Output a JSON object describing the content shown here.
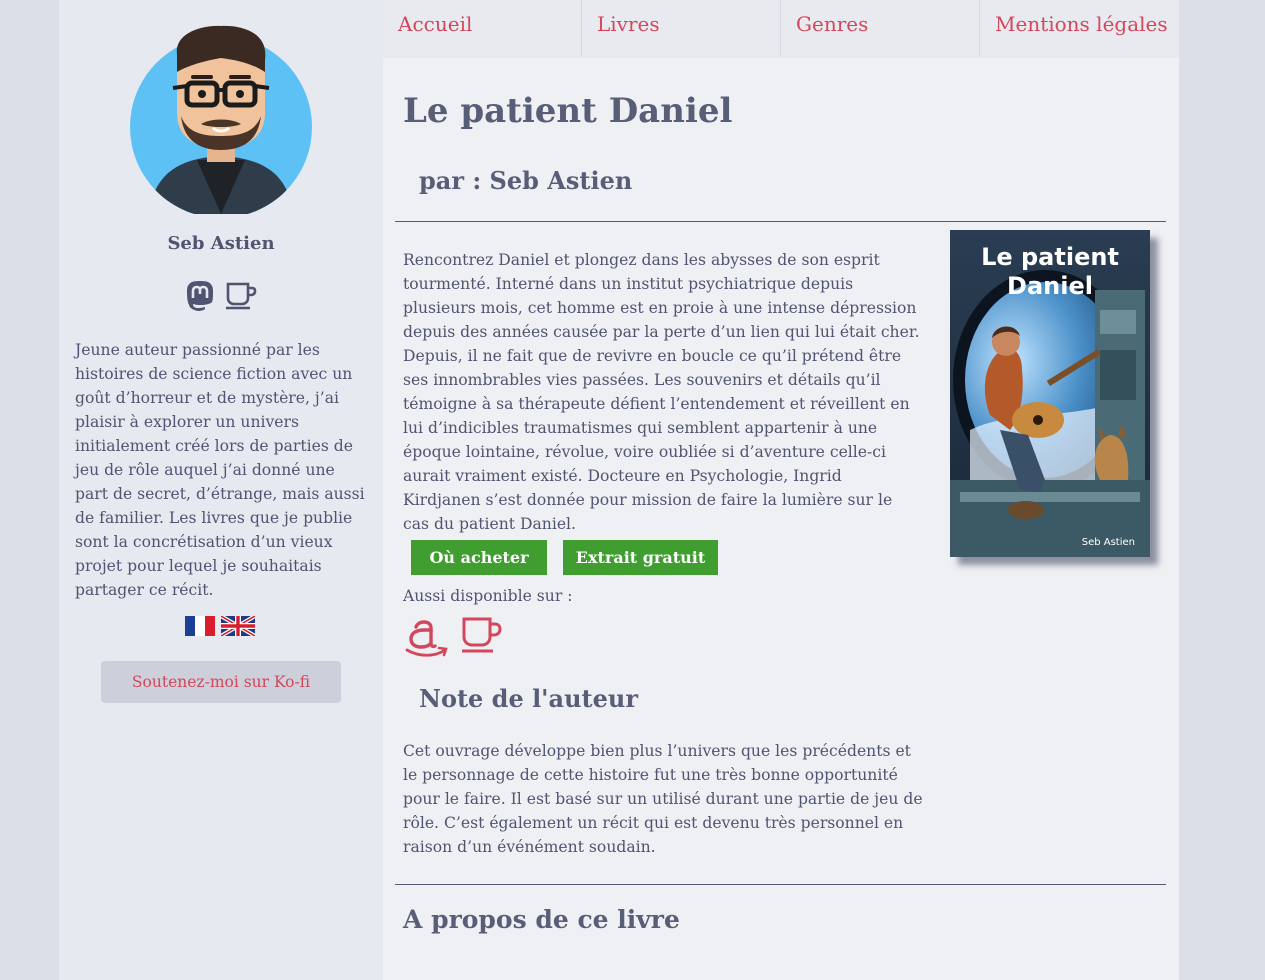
{
  "nav": {
    "items": [
      "Accueil",
      "Livres",
      "Genres",
      "Mentions légales"
    ]
  },
  "sidebar": {
    "author_name": "Seb Astien",
    "social_icons": [
      "mastodon-icon",
      "kofi-cup-icon"
    ],
    "bio": "Jeune auteur passionné par les histoires de science fiction avec un goût d’horreur et de mystère, j’ai plaisir à explorer un univers initialement créé lors de parties de jeu de rôle auquel j’ai donné une part de secret, d’étrange, mais aussi de familier. Les livres que je publie sont la concrétisation d’un vieux projet pour lequel je souhaitais partager ce récit.",
    "flags": [
      "flag-fr-icon",
      "flag-uk-icon"
    ],
    "kofi_button": "Soutenez-moi sur Ko-fi"
  },
  "book": {
    "title": "Le patient Daniel",
    "byline": "par : Seb Astien",
    "description": "Rencontrez Daniel et plongez dans les abysses de son esprit tourmenté. Interné dans un institut psychiatrique depuis plusieurs mois, cet homme est en proie à une intense dépression depuis des années causée par la perte d’un lien qui lui était cher. Depuis, il ne fait que de revivre en boucle ce qu’il prétend être ses innombrables vies passées. Les souvenirs et détails qu’il témoigne à sa thérapeute défient l’entendement et réveillent en lui d’indicibles traumatismes qui semblent appartenir à une époque lointaine, révolue, voire oubliée si d’aventure celle-ci aurait vraiment existé. Docteure en Psychologie, Ingrid Kirdjanen s’est donnée pour mission de faire la lumière sur le cas du patient Daniel.",
    "cover": {
      "title_line1": "Le patient",
      "title_line2": "Daniel",
      "author": "Seb Astien"
    },
    "buy_button": "Où acheter",
    "extract_button": "Extrait gratuit",
    "also_available": "Aussi disponible sur :",
    "store_icons": [
      "amazon-icon",
      "kofi-cup-icon"
    ]
  },
  "author_note": {
    "heading": "Note de l'auteur",
    "text": "Cet ouvrage développe bien plus l’univers que les précédents et le personnage de cette histoire fut une très bonne opportunité pour le faire. Il est basé sur un utilisé durant une partie de jeu de rôle. C’est également un récit qui est devenu très personnel en raison d’un événément soudain."
  },
  "about": {
    "heading": "A propos de ce livre"
  },
  "colors": {
    "accent": "#d2475b",
    "text": "#4f5470",
    "button_green": "#3f9e2f",
    "background": "#e7e9f0"
  }
}
